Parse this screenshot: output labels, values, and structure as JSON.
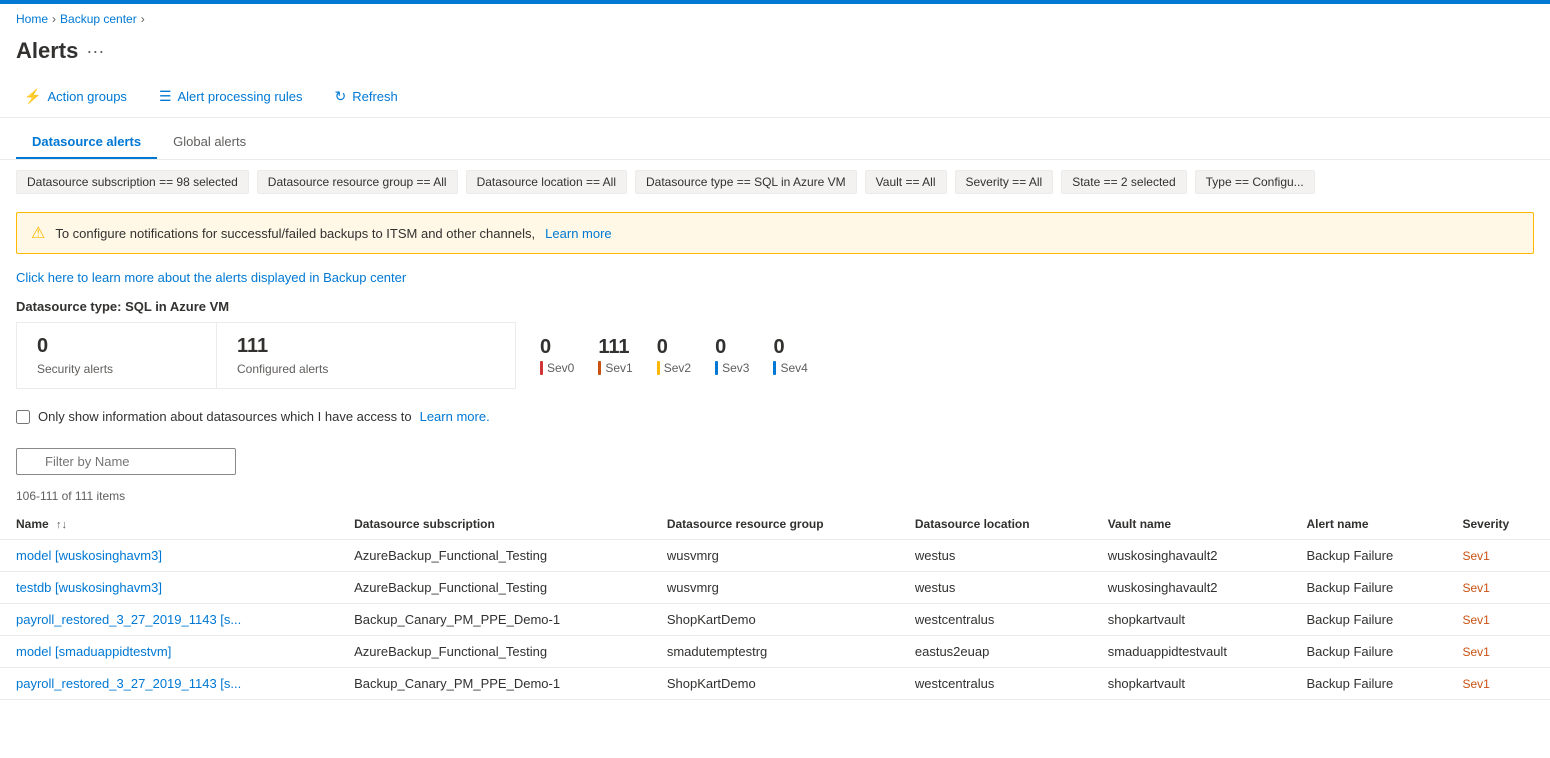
{
  "topBar": {},
  "breadcrumb": {
    "home": "Home",
    "backupCenter": "Backup center"
  },
  "header": {
    "title": "Alerts",
    "menuIcon": "···"
  },
  "toolbar": {
    "actionGroups": "Action groups",
    "alertProcessingRules": "Alert processing rules",
    "refresh": "Refresh"
  },
  "tabs": [
    {
      "label": "Datasource alerts",
      "active": true
    },
    {
      "label": "Global alerts",
      "active": false
    }
  ],
  "filters": [
    {
      "text": "Datasource subscription == 98 selected"
    },
    {
      "text": "Datasource resource group == All"
    },
    {
      "text": "Datasource location == All"
    },
    {
      "text": "Datasource type == SQL in Azure VM"
    },
    {
      "text": "Vault == All"
    },
    {
      "text": "Severity == All"
    },
    {
      "text": "State == 2 selected"
    },
    {
      "text": "Type == Configu..."
    }
  ],
  "alertBanner": {
    "text": "To configure notifications for successful/failed backups to ITSM and other channels,",
    "linkText": "Learn more"
  },
  "infoLink": {
    "text": "Click here to learn more about the alerts displayed in Backup center"
  },
  "sectionTitle": "Datasource type: SQL in Azure VM",
  "securityCard": {
    "number": "0",
    "label": "Security alerts"
  },
  "configuredCard": {
    "number": "111",
    "label": "Configured alerts"
  },
  "sevStats": [
    {
      "number": "0",
      "label": "Sev0",
      "colorClass": "sev0"
    },
    {
      "number": "111",
      "label": "Sev1",
      "colorClass": "sev1"
    },
    {
      "number": "0",
      "label": "Sev2",
      "colorClass": "sev2"
    },
    {
      "number": "0",
      "label": "Sev3",
      "colorClass": "sev3"
    },
    {
      "number": "0",
      "label": "Sev4",
      "colorClass": "sev4"
    }
  ],
  "checkboxRow": {
    "label": "Only show information about datasources which I have access to",
    "linkText": "Learn more."
  },
  "filterInput": {
    "placeholder": "Filter by Name"
  },
  "itemsCount": "106-111 of 111 items",
  "tableHeaders": [
    {
      "label": "Name",
      "sortable": true
    },
    {
      "label": "Datasource subscription"
    },
    {
      "label": "Datasource resource group"
    },
    {
      "label": "Datasource location"
    },
    {
      "label": "Vault name"
    },
    {
      "label": "Alert name"
    },
    {
      "label": "Severity"
    }
  ],
  "tableRows": [
    {
      "name": "model [wuskosinghavm3]",
      "subscription": "AzureBackup_Functional_Testing",
      "resourceGroup": "wusvmrg",
      "location": "westus",
      "vaultName": "wuskosinghavault2",
      "alertName": "Backup Failure",
      "severity": "Sev1"
    },
    {
      "name": "testdb [wuskosinghavm3]",
      "subscription": "AzureBackup_Functional_Testing",
      "resourceGroup": "wusvmrg",
      "location": "westus",
      "vaultName": "wuskosinghavault2",
      "alertName": "Backup Failure",
      "severity": "Sev1"
    },
    {
      "name": "payroll_restored_3_27_2019_1143 [s...",
      "subscription": "Backup_Canary_PM_PPE_Demo-1",
      "resourceGroup": "ShopKartDemo",
      "location": "westcentralus",
      "vaultName": "shopkartvault",
      "alertName": "Backup Failure",
      "severity": "Sev1"
    },
    {
      "name": "model [smaduappidtestvm]",
      "subscription": "AzureBackup_Functional_Testing",
      "resourceGroup": "smadutemptestrg",
      "location": "eastus2euap",
      "vaultName": "smaduappidtestvault",
      "alertName": "Backup Failure",
      "severity": "Sev1"
    },
    {
      "name": "payroll_restored_3_27_2019_1143 [s...",
      "subscription": "Backup_Canary_PM_PPE_Demo-1",
      "resourceGroup": "ShopKartDemo",
      "location": "westcentralus",
      "vaultName": "shopkartvault",
      "alertName": "Backup Failure",
      "severity": "Sev1"
    }
  ]
}
